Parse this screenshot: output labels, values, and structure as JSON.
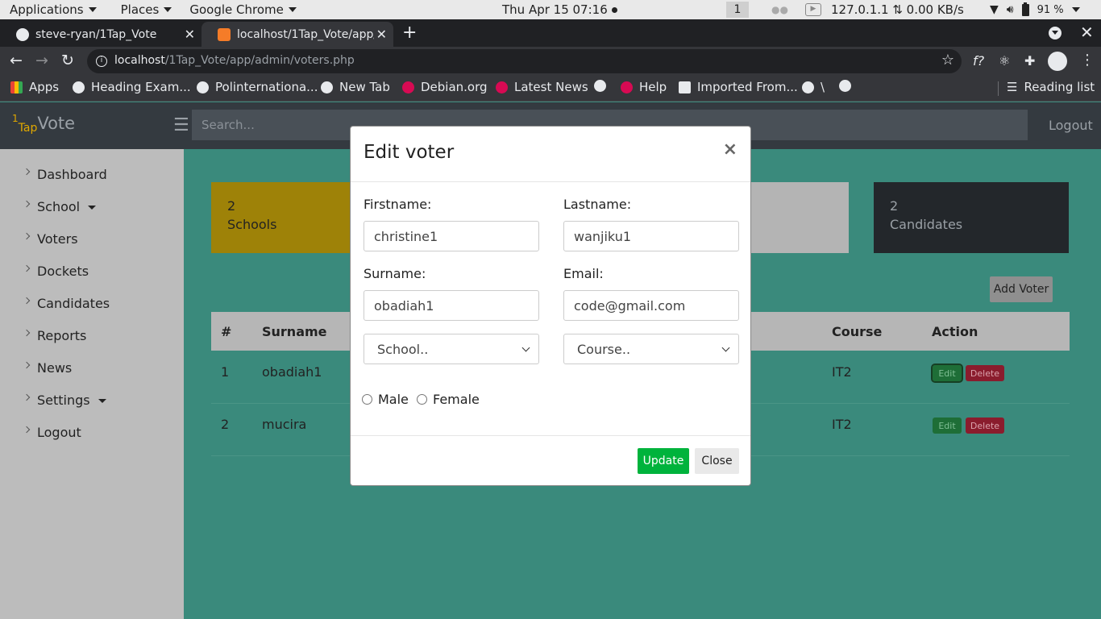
{
  "system_bar": {
    "applications": "Applications",
    "places": "Places",
    "browser_menu": "Google Chrome",
    "clock": "Thu Apr 15  07:16",
    "workspace": "1",
    "network": "127.0.1.1 ⇅ 0.00 KB/s",
    "battery": "91 %"
  },
  "browser": {
    "tabs": [
      {
        "title": "steve-ryan/1Tap_Vote",
        "icon": "github-icon"
      },
      {
        "title": "localhost/1Tap_Vote/app/",
        "icon": "xampp-icon",
        "active": true
      }
    ],
    "url_host": "localhost",
    "url_path": "/1Tap_Vote/app/admin/voters.php",
    "bookmarks": [
      {
        "label": "Apps",
        "icon": "apps-grid-icon"
      },
      {
        "label": "Heading Exam...",
        "icon": "globe-icon"
      },
      {
        "label": "Polinternationa...",
        "icon": "globe-icon"
      },
      {
        "label": "New Tab",
        "icon": "globe-icon"
      },
      {
        "label": "Debian.org",
        "icon": "debian-icon"
      },
      {
        "label": "Latest News",
        "icon": "debian-icon"
      },
      {
        "label": "",
        "icon": "globe-icon"
      },
      {
        "label": "Help",
        "icon": "debian-icon"
      },
      {
        "label": "Imported From...",
        "icon": "folder-icon"
      },
      {
        "label": "\\",
        "icon": "globe-icon"
      },
      {
        "label": "",
        "icon": "globe-icon"
      }
    ],
    "reading_list": "Reading list"
  },
  "app": {
    "brand_sup": "1",
    "brand_sub": "Tap",
    "brand_main": "Vote",
    "search_placeholder": "Search...",
    "logout": "Logout"
  },
  "sidebar": {
    "items": [
      {
        "label": "Dashboard",
        "dropdown": false
      },
      {
        "label": "School",
        "dropdown": true
      },
      {
        "label": "Voters",
        "dropdown": false
      },
      {
        "label": "Dockets",
        "dropdown": false
      },
      {
        "label": "Candidates",
        "dropdown": false
      },
      {
        "label": "Reports",
        "dropdown": false
      },
      {
        "label": "News",
        "dropdown": false
      },
      {
        "label": "Settings",
        "dropdown": true
      },
      {
        "label": "Logout",
        "dropdown": false
      }
    ]
  },
  "cards": {
    "schools": {
      "count": "2",
      "label": "Schools"
    },
    "candidates": {
      "count": "2",
      "label": "Candidates"
    }
  },
  "voters": {
    "add_button": "Add Voter",
    "columns": {
      "num": "#",
      "surname": "Surname",
      "course": "Course",
      "action": "Action"
    },
    "rows": [
      {
        "num": "1",
        "surname": "obadiah1",
        "course": "IT2"
      },
      {
        "num": "2",
        "surname": "mucira",
        "course": "IT2"
      }
    ],
    "edit_label": "Edit",
    "delete_label": "Delete"
  },
  "modal": {
    "title": "Edit voter",
    "close_glyph": "×",
    "firstname_label": "Firstname:",
    "firstname_value": "christine1",
    "lastname_label": "Lastname:",
    "lastname_value": "wanjiku1",
    "surname_label": "Surname:",
    "surname_value": "obadiah1",
    "email_label": "Email:",
    "email_value": "code@gmail.com",
    "school_select": "School..",
    "course_select": "Course..",
    "gender_male": "Male",
    "gender_female": "Female",
    "update_button": "Update",
    "close_button": "Close"
  },
  "colors": {
    "accent_green": "#00b33c",
    "main_bg": "#3a8a7c",
    "schools_card": "#9e8208"
  }
}
